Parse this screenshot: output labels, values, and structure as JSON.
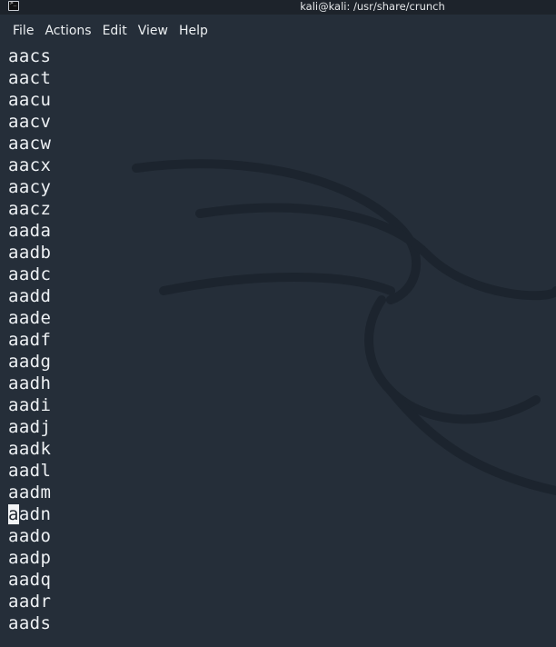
{
  "window": {
    "title": "kali@kali: /usr/share/crunch"
  },
  "menu": [
    "File",
    "Actions",
    "Edit",
    "View",
    "Help"
  ],
  "terminal": {
    "lines": [
      "aacs",
      "aact",
      "aacu",
      "aacv",
      "aacw",
      "aacx",
      "aacy",
      "aacz",
      "aada",
      "aadb",
      "aadc",
      "aadd",
      "aade",
      "aadf",
      "aadg",
      "aadh",
      "aadi",
      "aadj",
      "aadk",
      "aadl",
      "aadm",
      "aadn",
      "aado",
      "aadp",
      "aadq",
      "aadr",
      "aads"
    ],
    "cursor_line_index": 21,
    "cursor_char": "a",
    "cursor_rest": "adn"
  },
  "colors": {
    "background": "#252e39",
    "text": "#eef1f4",
    "titlebar": "#1d232b"
  }
}
